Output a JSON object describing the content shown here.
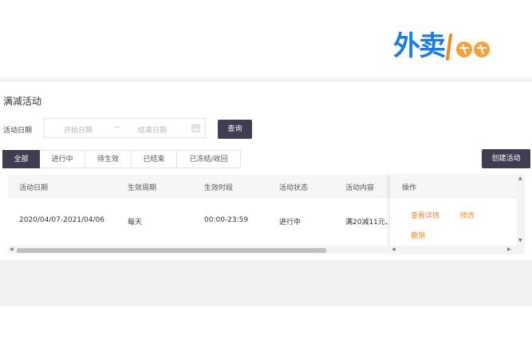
{
  "logo": {
    "text": "外卖"
  },
  "page": {
    "title": "满减活动"
  },
  "filter": {
    "date_label": "活动日期",
    "start_placeholder": "开始日期",
    "separator": "~",
    "end_placeholder": "结束日期",
    "query_button": "查询"
  },
  "tabs": [
    {
      "label": "全部",
      "active": true
    },
    {
      "label": "进行中"
    },
    {
      "label": "待生效"
    },
    {
      "label": "已结束"
    },
    {
      "label": "已冻结/收回"
    }
  ],
  "create_button": "创建活动",
  "table": {
    "columns": [
      "活动日期",
      "生效周期",
      "生效时段",
      "活动状态",
      "活动内容",
      "操作"
    ],
    "rows": [
      {
        "date": "2020/04/07-2021/04/06",
        "cycle": "每天",
        "period": "00:00-23:59",
        "status": "进行中",
        "content": "满20减11元、",
        "actions": [
          "查看详情",
          "修改",
          "撤销"
        ]
      }
    ]
  },
  "colors": {
    "primary_dark": "#3d3f51",
    "link_orange": "#f08a24",
    "logo_blue": "#1a7de6"
  }
}
